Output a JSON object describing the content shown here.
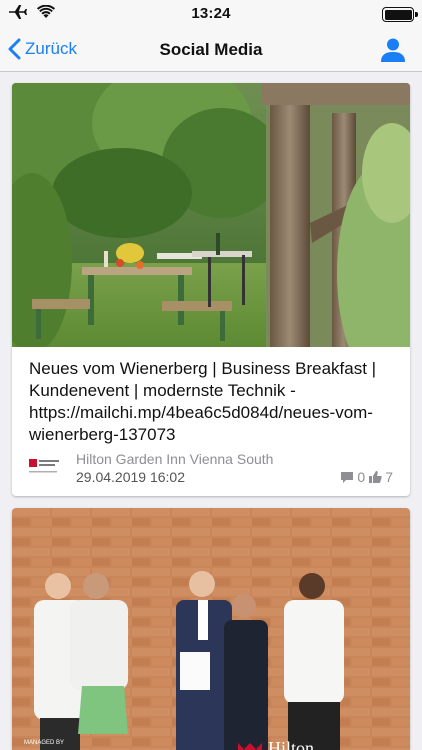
{
  "status_bar": {
    "time": "13:24",
    "icons": [
      "airplane-icon",
      "wifi-icon",
      "battery-icon"
    ]
  },
  "nav": {
    "back_label": "Zurück",
    "title": "Social Media",
    "profile_icon": "person-icon",
    "accent": "#1a7ff5"
  },
  "posts": [
    {
      "text": "Neues vom Wienerberg | Business Breakfast | Kundenevent | modernste Technik - https://mailchi.mp/4bea6c5d084d/neues-vom-wienerberg-137073",
      "author": "Hilton Garden Inn Vienna South",
      "date": "29.04.2019 16:02",
      "comments": "0",
      "likes": "7",
      "image": "garden-table-photo"
    },
    {
      "image": "staff-group-photo",
      "watermark_text": "MANAGED BY",
      "brand_text": "Hilton"
    }
  ]
}
